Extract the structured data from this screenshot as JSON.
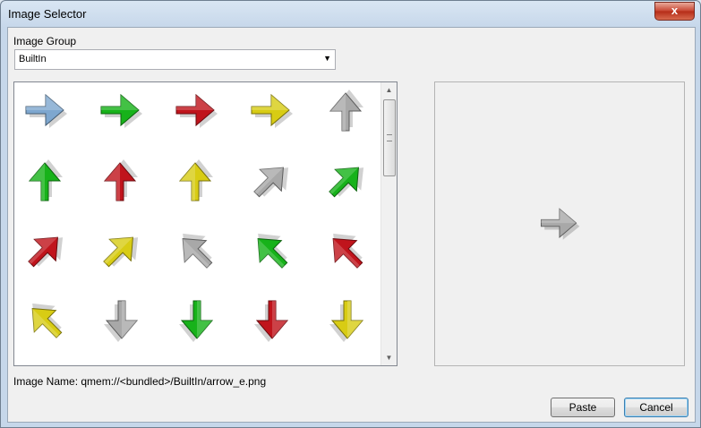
{
  "window": {
    "title": "Image Selector",
    "close_label": "x"
  },
  "image_group": {
    "label": "Image Group",
    "value": "BuiltIn"
  },
  "image_name": {
    "label": "Image Name: qmem://<bundled>/BuiltIn/arrow_e.png"
  },
  "buttons": {
    "paste": "Paste",
    "cancel": "Cancel"
  },
  "colors": {
    "blue": "#7ea7cf",
    "green": "#17b21a",
    "red": "#c0141c",
    "yellow": "#d8cc14",
    "gray": "#a8a8a8"
  },
  "icons": [
    {
      "name": "arrow-e-blue-icon",
      "dir": "e",
      "color": "blue"
    },
    {
      "name": "arrow-e-green-icon",
      "dir": "e",
      "color": "green"
    },
    {
      "name": "arrow-e-red-icon",
      "dir": "e",
      "color": "red"
    },
    {
      "name": "arrow-e-yellow-icon",
      "dir": "e",
      "color": "yellow"
    },
    {
      "name": "arrow-n-gray-icon",
      "dir": "n",
      "color": "gray"
    },
    {
      "name": "arrow-n-green-icon",
      "dir": "n",
      "color": "green"
    },
    {
      "name": "arrow-n-red-icon",
      "dir": "n",
      "color": "red"
    },
    {
      "name": "arrow-n-yellow-icon",
      "dir": "n",
      "color": "yellow"
    },
    {
      "name": "arrow-ne-gray-icon",
      "dir": "ne",
      "color": "gray"
    },
    {
      "name": "arrow-ne-green-icon",
      "dir": "ne",
      "color": "green"
    },
    {
      "name": "arrow-ne-red-icon",
      "dir": "ne",
      "color": "red"
    },
    {
      "name": "arrow-ne-yellow-icon",
      "dir": "ne",
      "color": "yellow"
    },
    {
      "name": "arrow-nw-gray-icon",
      "dir": "nw",
      "color": "gray"
    },
    {
      "name": "arrow-nw-green-icon",
      "dir": "nw",
      "color": "green"
    },
    {
      "name": "arrow-nw-red-icon",
      "dir": "nw",
      "color": "red"
    },
    {
      "name": "arrow-nw-yellow-icon",
      "dir": "nw",
      "color": "yellow"
    },
    {
      "name": "arrow-s-gray-icon",
      "dir": "s",
      "color": "gray"
    },
    {
      "name": "arrow-s-green-icon",
      "dir": "s",
      "color": "green"
    },
    {
      "name": "arrow-s-red-icon",
      "dir": "s",
      "color": "red"
    },
    {
      "name": "arrow-s-yellow-icon",
      "dir": "s",
      "color": "yellow"
    }
  ],
  "preview_icon": {
    "name": "arrow-e-gray-preview-icon",
    "dir": "e",
    "color": "gray"
  }
}
